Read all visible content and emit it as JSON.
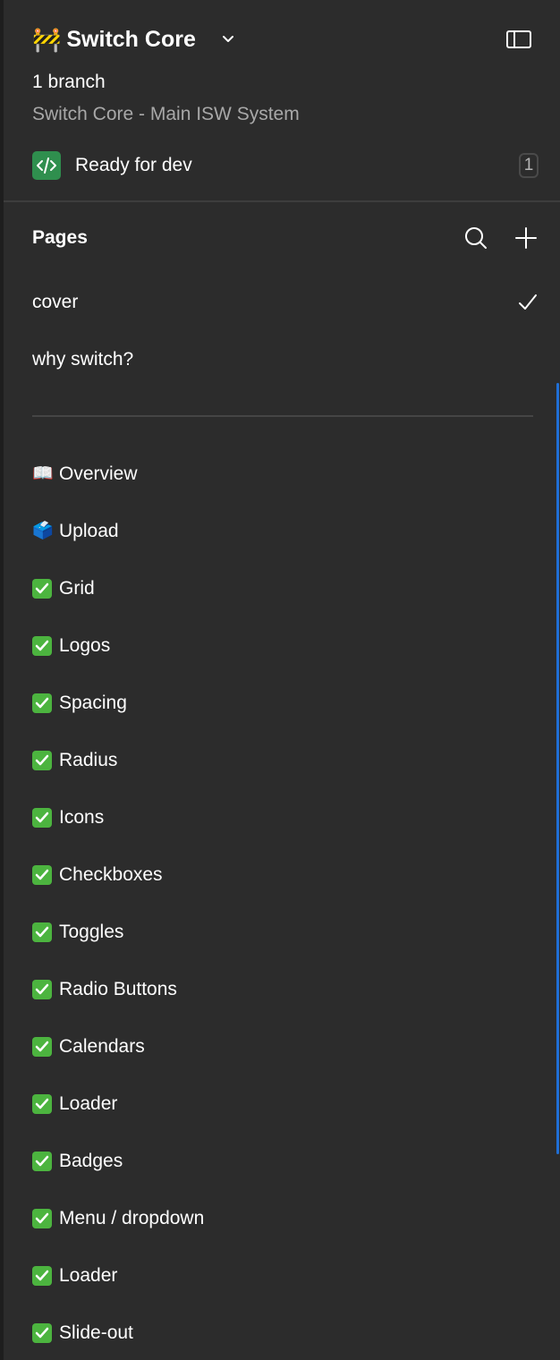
{
  "header": {
    "file_emoji": "🚧",
    "file_title": "Switch Core",
    "branch_count": "1 branch",
    "description": "Switch Core - Main ISW System",
    "dev_status_label": "Ready for dev",
    "dev_status_count": "1"
  },
  "pages": {
    "title": "Pages",
    "items": [
      {
        "label": "cover",
        "selected": true
      },
      {
        "label": "why switch?",
        "selected": false
      }
    ],
    "sections": [
      {
        "icon": "open-book",
        "emoji": "📖",
        "label": "Overview"
      },
      {
        "icon": "ballot-box",
        "emoji": "🗳️",
        "label": "Upload"
      },
      {
        "icon": "check-box",
        "label": "Grid"
      },
      {
        "icon": "check-box",
        "label": "Logos"
      },
      {
        "icon": "check-box",
        "label": "Spacing"
      },
      {
        "icon": "check-box",
        "label": "Radius"
      },
      {
        "icon": "check-box",
        "label": "Icons"
      },
      {
        "icon": "check-box",
        "label": "Checkboxes"
      },
      {
        "icon": "check-box",
        "label": "Toggles"
      },
      {
        "icon": "check-box",
        "label": "Radio Buttons"
      },
      {
        "icon": "check-box",
        "label": "Calendars"
      },
      {
        "icon": "check-box",
        "label": "Loader"
      },
      {
        "icon": "check-box",
        "label": "Badges"
      },
      {
        "icon": "check-box",
        "label": "Menu / dropdown"
      },
      {
        "icon": "check-box",
        "label": "Loader"
      },
      {
        "icon": "check-box",
        "label": "Slide-out"
      }
    ]
  },
  "colors": {
    "panel_bg": "#2c2c2c",
    "dev_green": "#2f8f4e",
    "check_green": "#4cb43f",
    "scroll_blue": "#1f6fd6",
    "muted_text": "#a8a8a8"
  }
}
